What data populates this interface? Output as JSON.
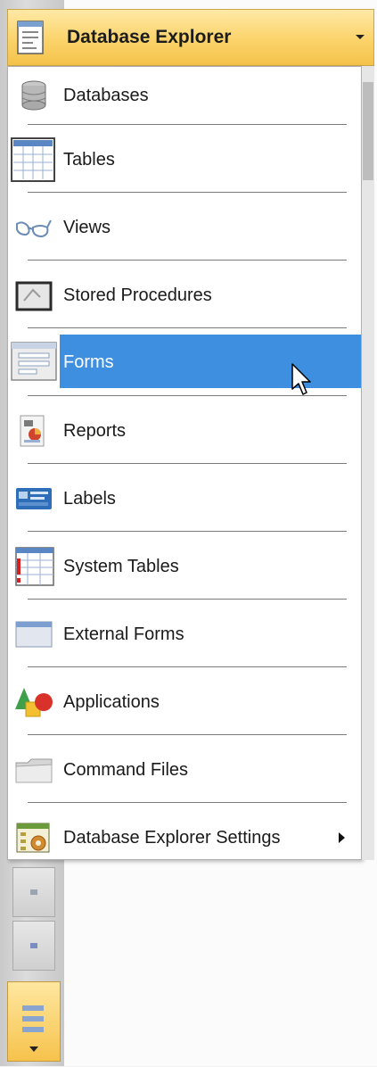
{
  "header": {
    "title": "Database Explorer"
  },
  "menu": {
    "items": [
      {
        "label": "Databases",
        "icon": "database-icon"
      },
      {
        "label": "Tables",
        "icon": "table-icon"
      },
      {
        "label": "Views",
        "icon": "glasses-icon"
      },
      {
        "label": "Stored Procedures",
        "icon": "stored-procedure-icon"
      },
      {
        "label": "Forms",
        "icon": "form-icon",
        "selected": true
      },
      {
        "label": "Reports",
        "icon": "report-icon"
      },
      {
        "label": "Labels",
        "icon": "label-icon"
      },
      {
        "label": "System Tables",
        "icon": "system-table-icon"
      },
      {
        "label": "External Forms",
        "icon": "external-form-icon"
      },
      {
        "label": "Applications",
        "icon": "application-icon"
      },
      {
        "label": "Command Files",
        "icon": "folder-icon"
      },
      {
        "label": "Database Explorer Settings",
        "icon": "settings-icon",
        "has_submenu": true
      }
    ]
  },
  "colors": {
    "header": "#f9cf5f",
    "selection": "#3f8fe0"
  }
}
